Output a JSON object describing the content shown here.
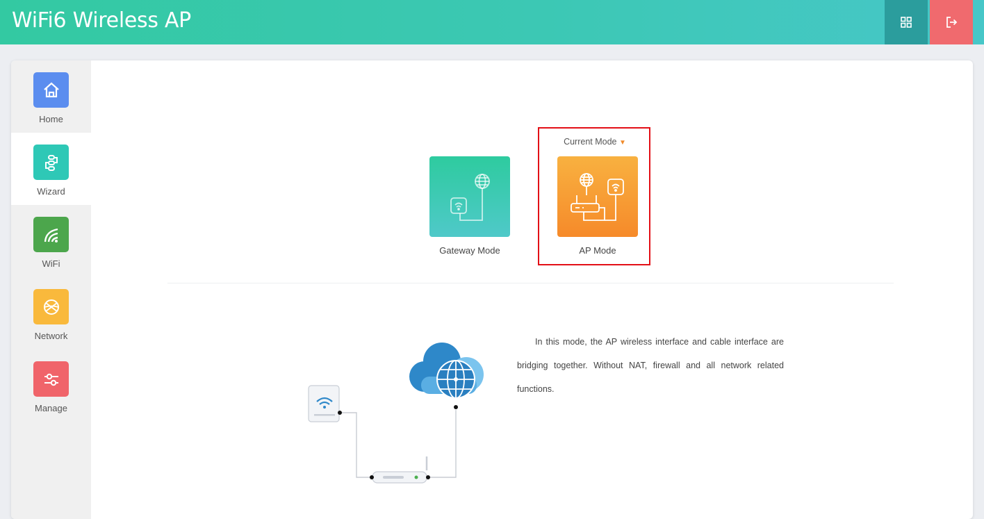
{
  "header": {
    "title": "WiFi6 Wireless AP",
    "grid_icon": "grid-icon",
    "logout_icon": "logout-icon"
  },
  "sidebar": {
    "items": [
      {
        "label": "Home",
        "icon": "home-icon",
        "color": "#5b8def"
      },
      {
        "label": "Wizard",
        "icon": "wizard-icon",
        "color": "#2ec8b6"
      },
      {
        "label": "WiFi",
        "icon": "wifi-icon",
        "color": "#4ca64c"
      },
      {
        "label": "Network",
        "icon": "globe-icon",
        "color": "#f9b93c"
      },
      {
        "label": "Manage",
        "icon": "sliders-icon",
        "color": "#f0646a"
      }
    ],
    "active": "Wizard"
  },
  "modes": {
    "current_label": "Current Mode",
    "gateway_label": "Gateway Mode",
    "ap_label": "AP Mode",
    "selected": "AP Mode"
  },
  "description": "In this mode, the AP wireless interface and cable interface are bridging together. Without NAT, firewall and all network related functions.",
  "colors": {
    "header_start": "#33c9a2",
    "header_end": "#47c7c8",
    "highlight": "#e30f16",
    "gateway_tile": "#2ecb9f",
    "ap_tile": "#f68a2a"
  }
}
